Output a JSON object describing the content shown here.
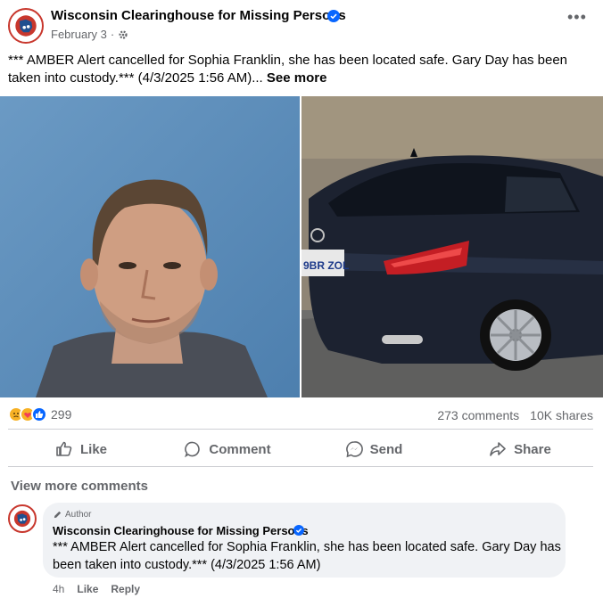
{
  "post": {
    "page_name": "Wisconsin Clearinghouse for Missing Persons",
    "date": "February 3",
    "privacy_icon": "gear-icon",
    "text": "*** AMBER Alert cancelled for Sophia Franklin, she has been located safe. Gary Day has been taken into custody.*** (4/3/2025 1:56 AM)...",
    "see_more": "See more",
    "plate_text": "9BR ZOL"
  },
  "engagement": {
    "reaction_icons": [
      "sad-icon",
      "care-icon",
      "like-icon"
    ],
    "reaction_count": "299",
    "comments": "273 comments",
    "shares": "10K shares"
  },
  "actions": {
    "like": "Like",
    "comment": "Comment",
    "send": "Send",
    "share": "Share"
  },
  "comments_section": {
    "view_more": "View more comments",
    "comment": {
      "author_badge": "Author",
      "name": "Wisconsin Clearinghouse for Missing Persons",
      "text": "*** AMBER Alert cancelled for Sophia Franklin, she has been located safe. Gary Day has been taken into custody.*** (4/3/2025 1:56 AM)",
      "time": "4h",
      "like": "Like",
      "reply": "Reply"
    }
  },
  "colors": {
    "accent_blue": "#0866ff",
    "muted_text": "#65676b",
    "bubble_bg": "#f0f2f5",
    "photo_bg_blue": "#5a8ab5",
    "car_color": "#1c2230"
  }
}
